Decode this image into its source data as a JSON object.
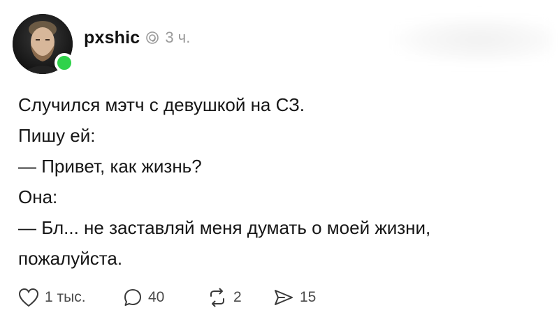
{
  "post": {
    "username": "pxshic",
    "time": "3 ч.",
    "user_online": true,
    "lines": [
      "Случился мэтч с девушкой на СЗ.",
      "Пишу ей:",
      "— Привет, как жизнь?",
      "Она:",
      "— Бл... не заставляй меня думать о моей жизни,",
      "пожалуйста."
    ]
  },
  "actions": {
    "likes": "1 тыс.",
    "comments": "40",
    "reposts": "2",
    "shares": "15"
  },
  "icons": {
    "verified": "threads-badge-icon",
    "like": "heart-icon",
    "comment": "comment-bubble-icon",
    "repost": "repost-icon",
    "share": "send-icon"
  },
  "colors": {
    "online": "#2fd24a",
    "secondary_text": "#9a9a9a"
  }
}
